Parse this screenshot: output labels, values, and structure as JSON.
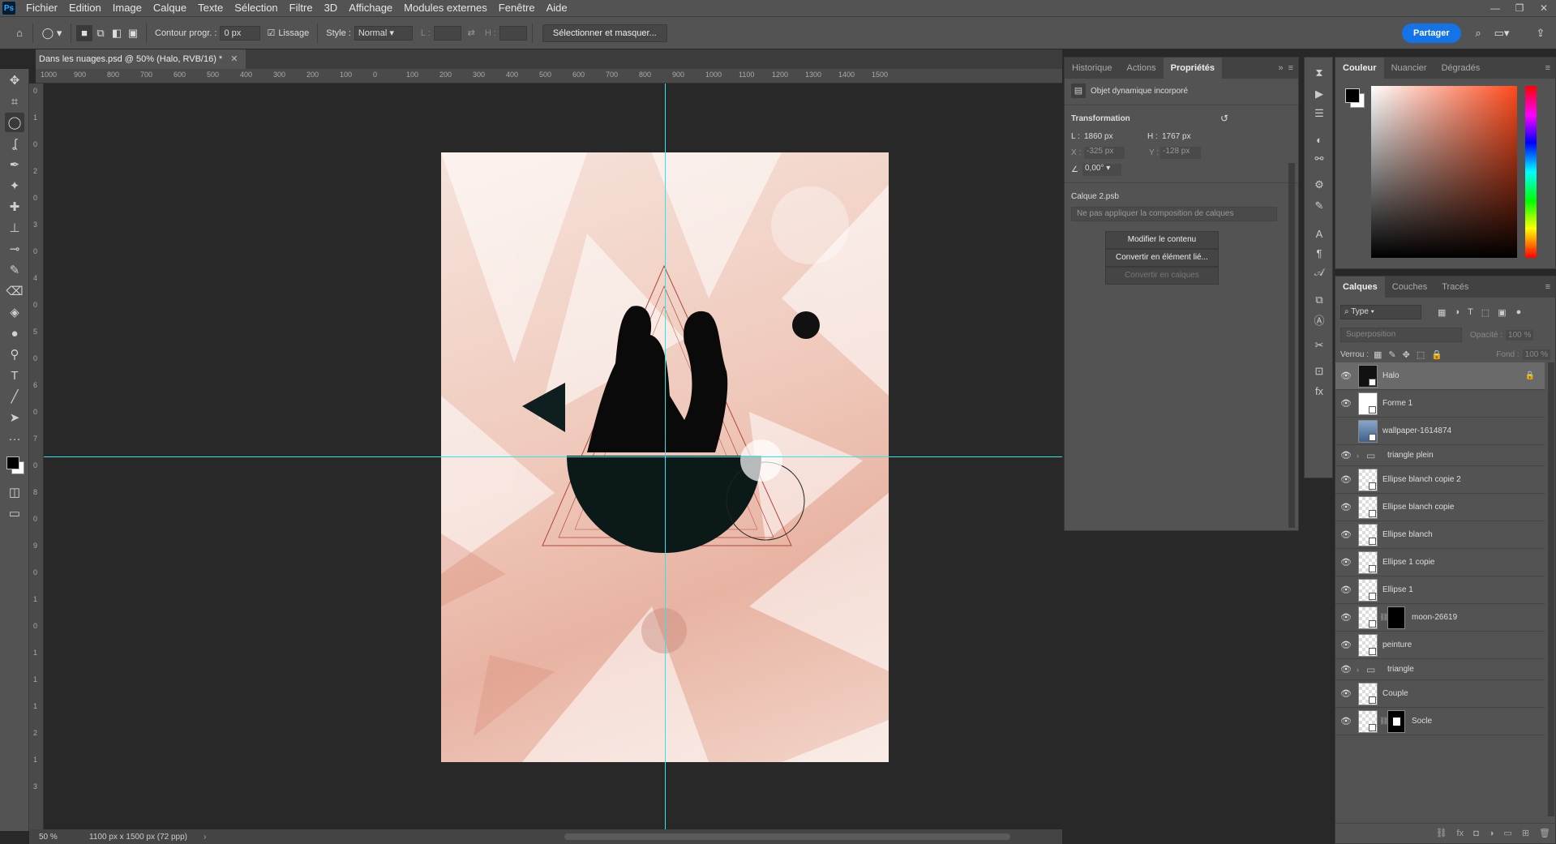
{
  "menu": {
    "logo": "Ps",
    "items": [
      "Fichier",
      "Edition",
      "Image",
      "Calque",
      "Texte",
      "Sélection",
      "Filtre",
      "3D",
      "Affichage",
      "Modules externes",
      "Fenêtre",
      "Aide"
    ],
    "window_controls": [
      "—",
      "❐",
      "✕"
    ]
  },
  "options": {
    "feather_label": "Contour progr. :",
    "feather_value": "0 px",
    "antialias_label": "Lissage",
    "style_label": "Style :",
    "style_value": "Normal",
    "width_label": "L :",
    "height_label": "H :",
    "select_mask_button": "Sélectionner et masquer...",
    "share_button": "Partager"
  },
  "document": {
    "tab_title": "Dans les nuages.psd @ 50% (Halo, RVB/16) *",
    "zoom": "50 %",
    "size_info": "1100 px x 1500 px (72 ppp)"
  },
  "rulers": {
    "h_labels": [
      "1000",
      "900",
      "800",
      "700",
      "600",
      "500",
      "400",
      "300",
      "200",
      "100",
      "0",
      "100",
      "200",
      "300",
      "400",
      "500",
      "600",
      "700",
      "800",
      "900",
      "1000",
      "1100",
      "1200",
      "1300",
      "1400",
      "1500"
    ],
    "v_labels": [
      "0",
      "1",
      "0",
      "2",
      "0",
      "3",
      "0",
      "4",
      "0",
      "5",
      "0",
      "6",
      "0",
      "7",
      "0",
      "8",
      "0",
      "9",
      "0",
      "1",
      "0",
      "1",
      "1",
      "1",
      "2",
      "1",
      "3"
    ]
  },
  "properties": {
    "tabs": [
      "Historique",
      "Actions",
      "Propriétés"
    ],
    "active_tab": 2,
    "object_type": "Objet dynamique incorporé",
    "section_transform": "Transformation",
    "w_label": "L :",
    "w_value": "1860 px",
    "h_label": "H :",
    "h_value": "1767 px",
    "x_label": "X :",
    "x_value": "-325 px",
    "y_label": "Y :",
    "y_value": "-128 px",
    "angle_value": "0,00°",
    "smart_object_name": "Calque 2.psb",
    "comp_select": "Ne pas appliquer la composition de calques",
    "btn_edit": "Modifier le contenu",
    "btn_convert_linked": "Convertir en élément lié...",
    "btn_convert_layers": "Convertir en calques"
  },
  "color_panel": {
    "tabs": [
      "Couleur",
      "Nuancier",
      "Dégradés"
    ],
    "fg_color": "#000000",
    "bg_color": "#ffffff"
  },
  "layers_panel": {
    "tabs": [
      "Calques",
      "Couches",
      "Tracés"
    ],
    "filter_value": "Type",
    "blend_mode": "Superposition",
    "opacity_label": "Opacité :",
    "opacity_value": "100 %",
    "lock_label": "Verrou :",
    "fill_label": "Fond :",
    "fill_value": "100 %",
    "layers": [
      {
        "name": "Halo",
        "visible": true,
        "selected": true,
        "kind": "smart-dark",
        "locked": true
      },
      {
        "name": "Forme 1",
        "visible": true,
        "kind": "smart"
      },
      {
        "name": "wallpaper-1614874",
        "visible": false,
        "kind": "photo"
      },
      {
        "name": "triangle plein",
        "visible": true,
        "kind": "group"
      },
      {
        "name": "Ellipse blanch copie 2",
        "visible": true,
        "kind": "smart"
      },
      {
        "name": "Ellipse blanch copie",
        "visible": true,
        "kind": "smart"
      },
      {
        "name": "Ellipse blanch",
        "visible": true,
        "kind": "smart"
      },
      {
        "name": "Ellipse 1 copie",
        "visible": true,
        "kind": "smart"
      },
      {
        "name": "Ellipse 1",
        "visible": true,
        "kind": "smart"
      },
      {
        "name": "moon-26619",
        "visible": true,
        "kind": "smart-mask"
      },
      {
        "name": "peinture",
        "visible": true,
        "kind": "smart"
      },
      {
        "name": "triangle",
        "visible": true,
        "kind": "group"
      },
      {
        "name": "Couple",
        "visible": true,
        "kind": "smart"
      },
      {
        "name": "Socle",
        "visible": true,
        "kind": "smart-mask-white"
      }
    ]
  }
}
